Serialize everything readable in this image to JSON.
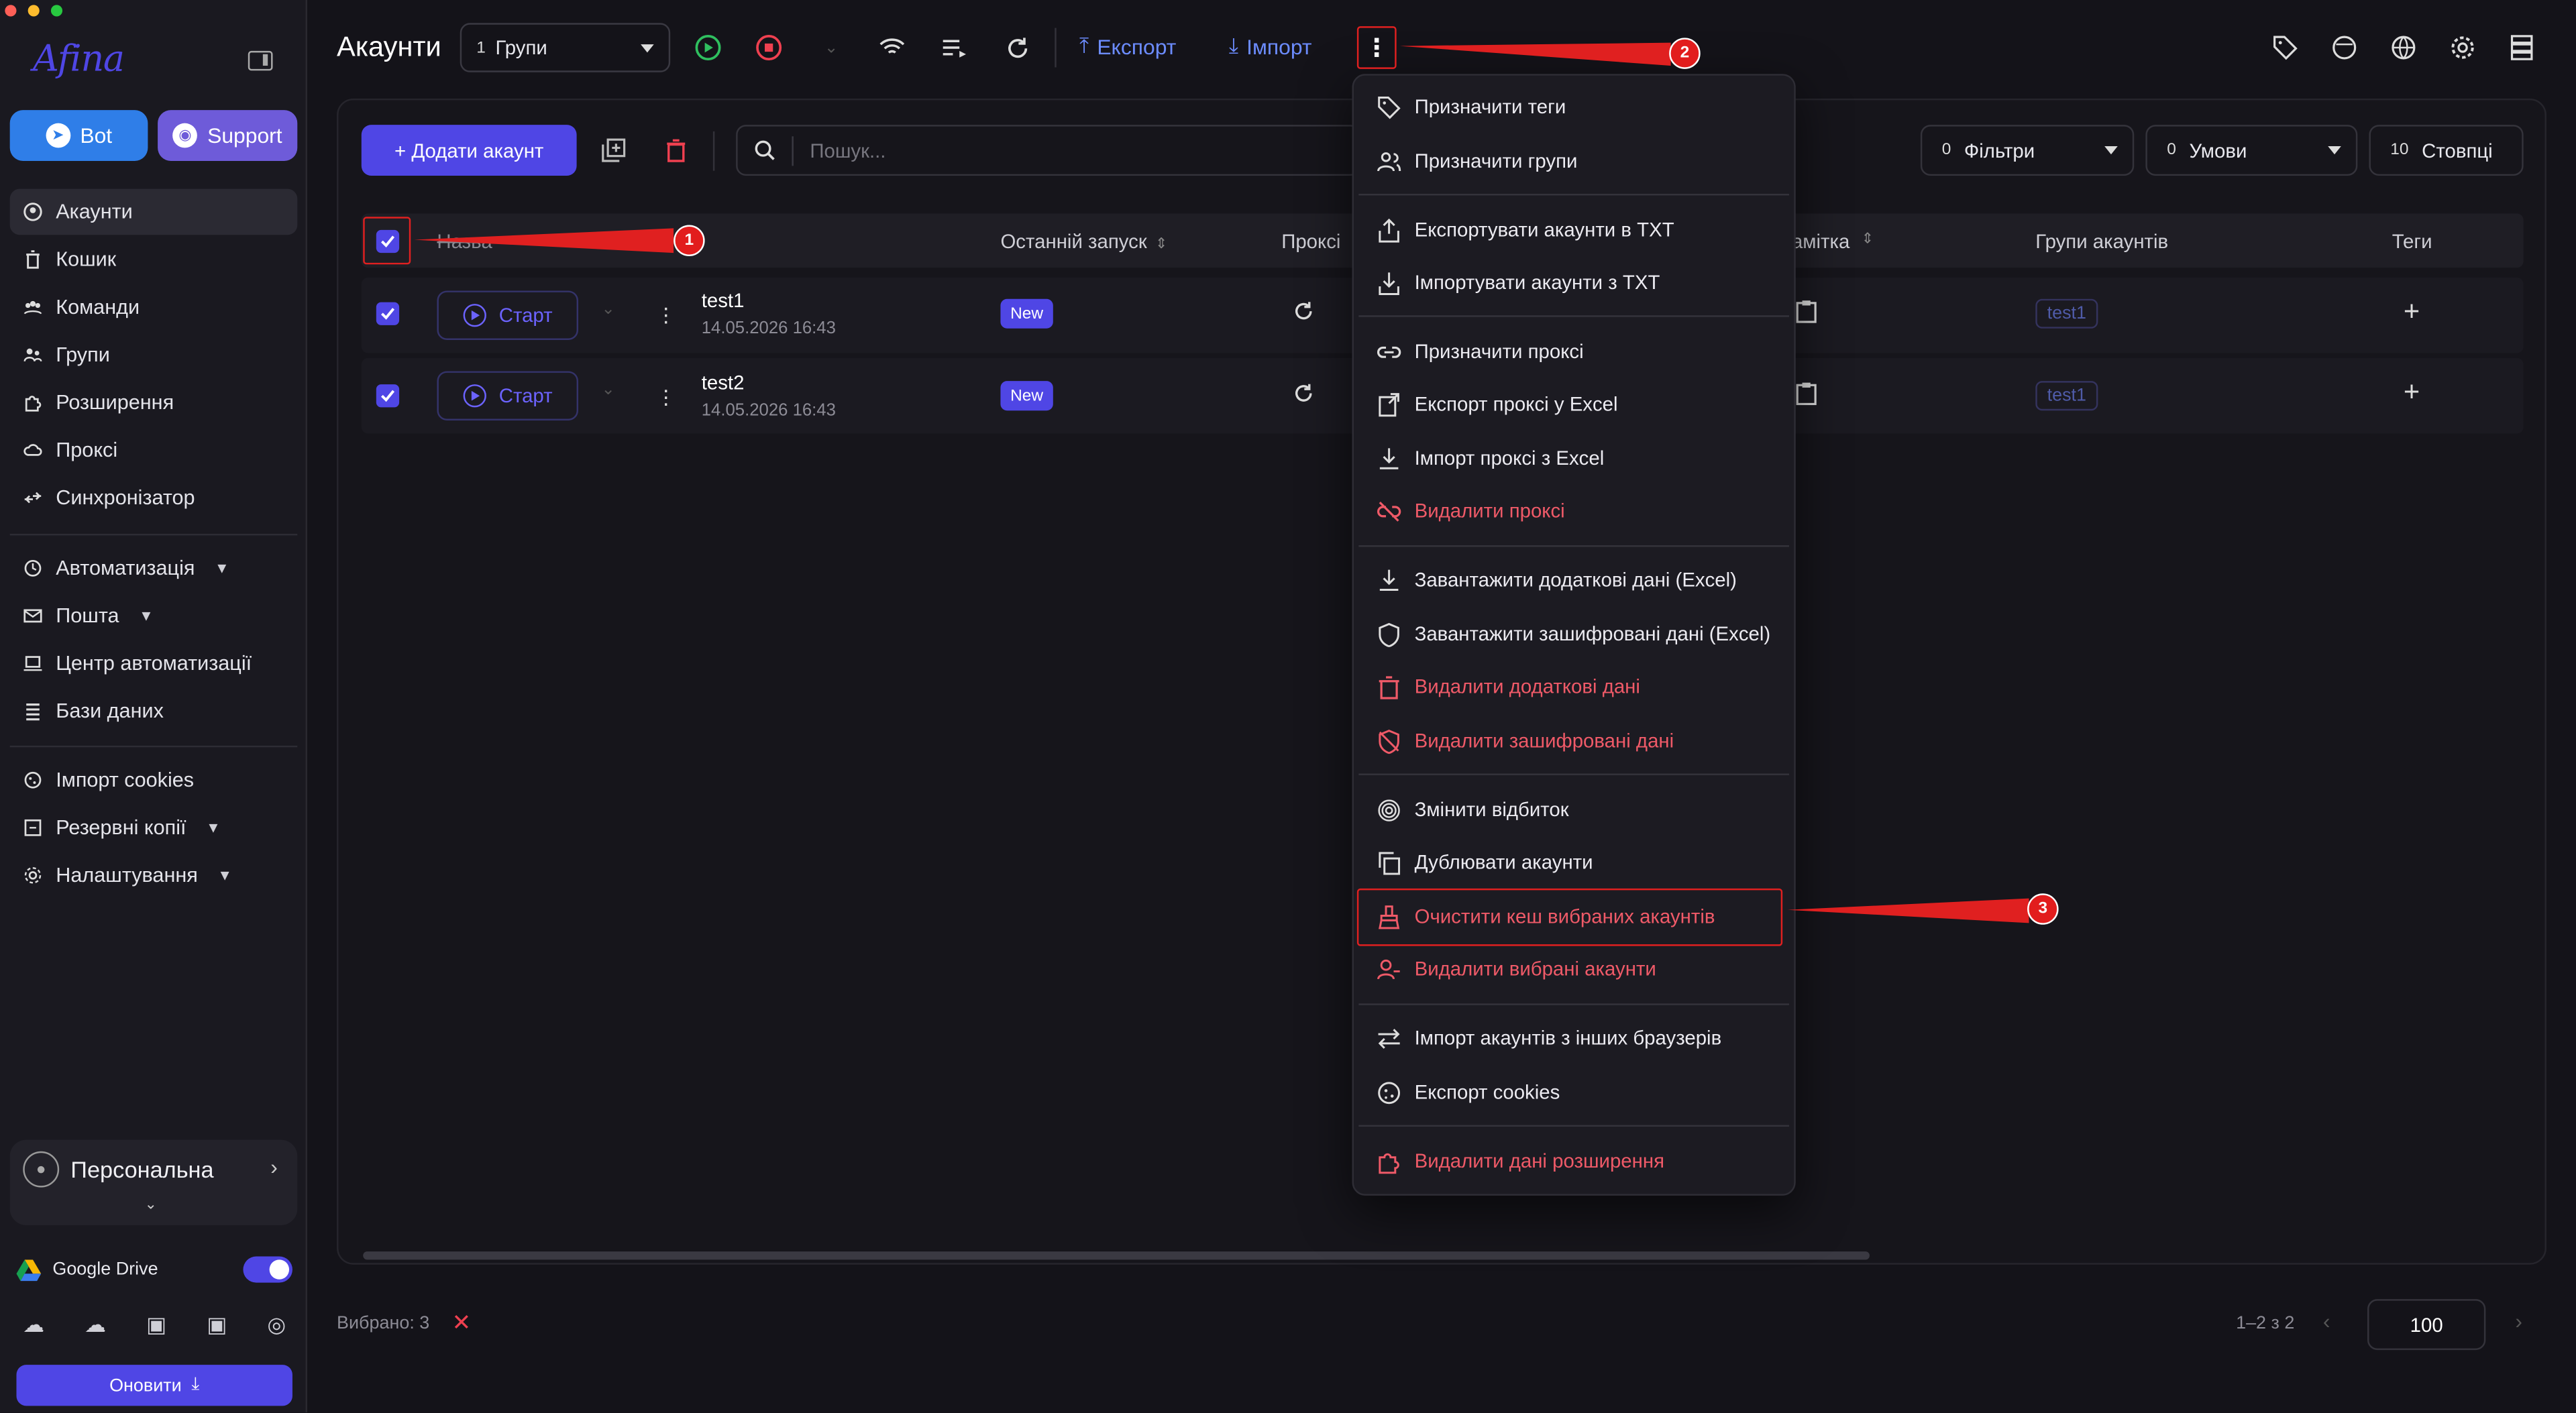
{
  "sidebar": {
    "logo": "Afina",
    "bot_label": "Bot",
    "support_label": "Support",
    "items": [
      {
        "label": "Акаунти",
        "icon": "user-icon"
      },
      {
        "label": "Кошик",
        "icon": "trash-icon"
      },
      {
        "label": "Команди",
        "icon": "team-icon"
      },
      {
        "label": "Групи",
        "icon": "group-icon"
      },
      {
        "label": "Розширення",
        "icon": "puzzle-icon"
      },
      {
        "label": "Проксі",
        "icon": "cloud-icon"
      },
      {
        "label": "Синхронізатор",
        "icon": "sync-icon"
      },
      {
        "label": "Автоматизація",
        "icon": "automation-icon"
      },
      {
        "label": "Пошта",
        "icon": "mail-icon"
      },
      {
        "label": "Центр автоматизації",
        "icon": "laptop-icon"
      },
      {
        "label": "Бази даних",
        "icon": "database-icon"
      },
      {
        "label": "Імпорт cookies",
        "icon": "cookie-icon"
      },
      {
        "label": "Резервні копії",
        "icon": "backup-icon"
      },
      {
        "label": "Налаштування",
        "icon": "gear-icon"
      }
    ],
    "profile_name": "Персональна",
    "drive_label": "Google Drive",
    "update_label": "Оновити"
  },
  "header": {
    "title": "Акаунти",
    "groups_count": "1",
    "groups_label": "Групи",
    "export_label": "Експорт",
    "import_label": "Імпорт"
  },
  "toolbar": {
    "add_label": "+ Додати акаунт",
    "search_placeholder": "Пошук...",
    "filters_count": "0",
    "filters_label": "Фільтри",
    "conditions_count": "0",
    "conditions_label": "Умови",
    "columns_count": "10",
    "columns_label": "Стовпці"
  },
  "table": {
    "columns": [
      "Назва",
      "Останній запуск",
      "Проксі",
      "Замітка",
      "Групи акаунтів",
      "Теги"
    ],
    "start_label": "Старт",
    "rows": [
      {
        "name": "test1",
        "date": "14.05.2026 16:43",
        "status": "New",
        "group": "test1"
      },
      {
        "name": "test2",
        "date": "14.05.2026 16:43",
        "status": "New",
        "group": "test1"
      }
    ]
  },
  "footer": {
    "selected": "Вибрано: 3",
    "range": "1–2 з 2",
    "per_page": "100"
  },
  "menu": {
    "items": [
      {
        "label": "Призначити теги",
        "icon": "tag-icon",
        "danger": false
      },
      {
        "label": "Призначити групи",
        "icon": "users-icon",
        "danger": false
      },
      {
        "label": "Експортувати акаунти в TXT",
        "icon": "export-icon",
        "danger": false
      },
      {
        "label": "Імпортувати акаунти з TXT",
        "icon": "import-icon",
        "danger": false
      },
      {
        "label": "Призначити проксі",
        "icon": "link-icon",
        "danger": false
      },
      {
        "label": "Експорт проксі у Excel",
        "icon": "export-excel-icon",
        "danger": false
      },
      {
        "label": "Імпорт проксі з Excel",
        "icon": "download-icon",
        "danger": false
      },
      {
        "label": "Видалити проксі",
        "icon": "unlink-icon",
        "danger": true
      },
      {
        "label": "Завантажити додаткові дані (Excel)",
        "icon": "download-icon",
        "danger": false
      },
      {
        "label": "Завантажити зашифровані дані (Excel)",
        "icon": "shield-icon",
        "danger": false
      },
      {
        "label": "Видалити додаткові дані",
        "icon": "trash-icon",
        "danger": true
      },
      {
        "label": "Видалити зашифровані дані",
        "icon": "shield-off-icon",
        "danger": true
      },
      {
        "label": "Змінити відбиток",
        "icon": "fingerprint-icon",
        "danger": false
      },
      {
        "label": "Дублювати акаунти",
        "icon": "copy-icon",
        "danger": false
      },
      {
        "label": "Очистити кеш вибраних акаунтів",
        "icon": "brush-icon",
        "danger": true
      },
      {
        "label": "Видалити вибрані акаунти",
        "icon": "user-remove-icon",
        "danger": true
      },
      {
        "label": "Імпорт акаунтів з інших браузерів",
        "icon": "swap-icon",
        "danger": false
      },
      {
        "label": "Експорт cookies",
        "icon": "cookie-icon",
        "danger": false
      },
      {
        "label": "Видалити дані розширення",
        "icon": "puzzle-icon",
        "danger": true
      }
    ]
  },
  "annotations": [
    "1",
    "2",
    "3"
  ],
  "colors": {
    "accent": "#4f46e5",
    "danger": "#ef5a68",
    "annotation": "#e21d1d",
    "background": "#141319"
  }
}
